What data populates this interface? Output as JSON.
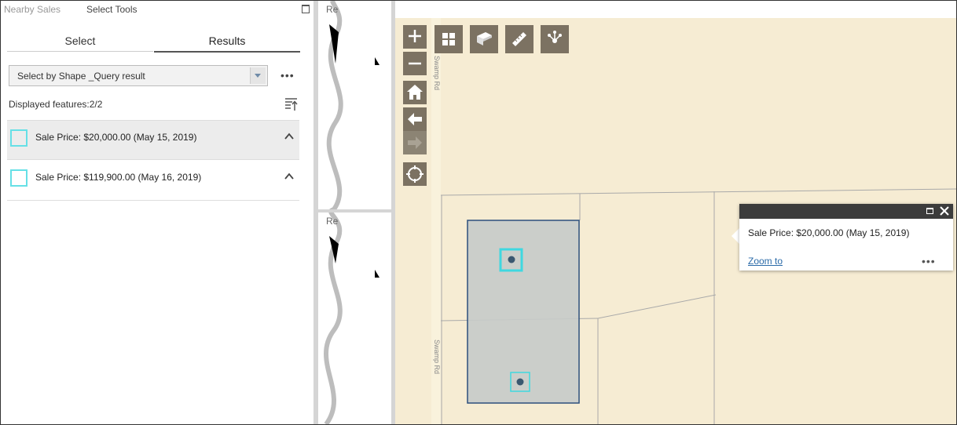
{
  "panel": {
    "header_tabs": [
      "Nearby Sales",
      "Select Tools"
    ],
    "tabs": {
      "select": "Select",
      "results": "Results"
    },
    "dropdown": {
      "value": "Select by Shape _Query result"
    },
    "more_label": "•••",
    "displayed_features": "Displayed features:2/2",
    "results": [
      {
        "label": "Sale Price: $20,000.00 (May 15, 2019)"
      },
      {
        "label": "Sale Price: $119,900.00 (May 16, 2019)"
      }
    ]
  },
  "middle": {
    "text_top": "Re",
    "text_bottom": "Re"
  },
  "map": {
    "road_name": "Swamp Rd",
    "popup": {
      "title": "Sale Price: $20,000.00 (May 15, 2019)",
      "zoom_label": "Zoom to",
      "more_label": "•••"
    },
    "colors": {
      "background": "#f6ecd3",
      "parcel_fill": "#c6cbc9",
      "parcel_stroke": "#2c4f7c",
      "highlight": "#3fd8e0"
    }
  }
}
